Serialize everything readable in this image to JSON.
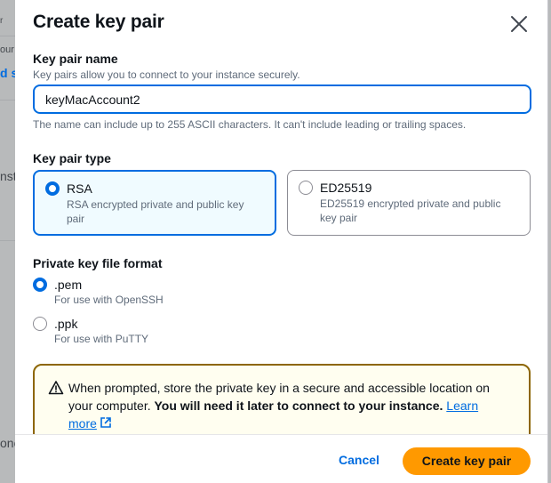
{
  "background": {
    "fragments": [
      "r",
      "our",
      "d s",
      "nst",
      "one"
    ]
  },
  "modal": {
    "title": "Create key pair",
    "key_pair_name": {
      "label": "Key pair name",
      "description": "Key pairs allow you to connect to your instance securely.",
      "value": "keyMacAccount2",
      "constraint": "The name can include up to 255 ASCII characters. It can't include leading or trailing spaces."
    },
    "key_pair_type": {
      "label": "Key pair type",
      "options": [
        {
          "title": "RSA",
          "description_line1": "RSA encrypted private and public key",
          "description_line2": "pair",
          "selected": true
        },
        {
          "title": "ED25519",
          "description_line1": "ED25519 encrypted private and public",
          "description_line2": "key pair",
          "selected": false
        }
      ]
    },
    "file_format": {
      "label": "Private key file format",
      "options": [
        {
          "title": ".pem",
          "description": "For use with OpenSSH",
          "selected": true
        },
        {
          "title": ".ppk",
          "description": "For use with PuTTY",
          "selected": false
        }
      ]
    },
    "alert": {
      "text_line1": "When prompted, store the private key in a secure and accessible location on",
      "text_line2_plain": "your computer. ",
      "text_line2_bold": "You will need it later to connect to your instance.",
      "link_line2": "Learn",
      "link_line3": "more"
    },
    "footer": {
      "cancel_label": "Cancel",
      "create_label": "Create key pair"
    }
  },
  "colors": {
    "accent": "#006ce0",
    "primary_button": "#ff9900",
    "warning_border": "#8d6605"
  },
  "icons": [
    "close-icon",
    "warning-icon",
    "external-link-icon"
  ]
}
